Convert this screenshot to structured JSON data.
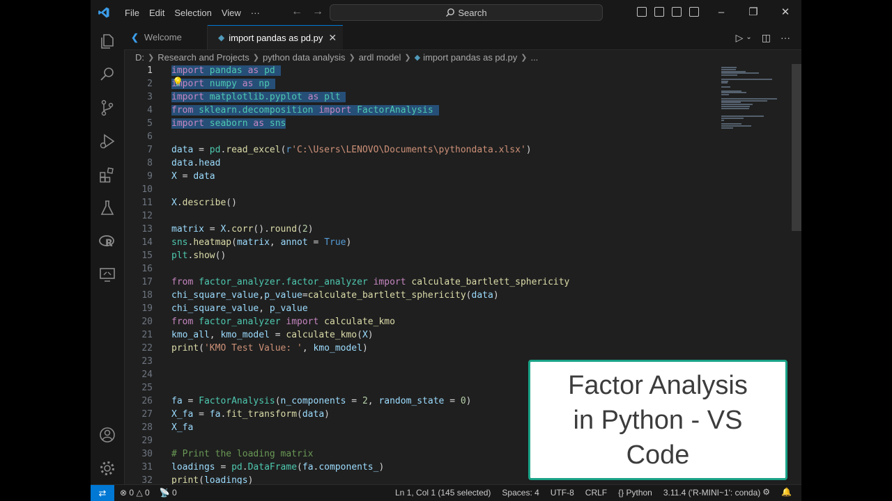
{
  "menu": [
    "File",
    "Edit",
    "Selection",
    "View",
    "···"
  ],
  "search_label": "Search",
  "tabs": [
    {
      "label": "Welcome"
    },
    {
      "label": "import pandas as pd.py"
    }
  ],
  "breadcrumb": [
    "D:",
    "Research and Projects",
    "python data analysis",
    "ardl model",
    "import pandas as pd.py",
    "..."
  ],
  "lines": [
    {
      "n": "1",
      "html": "<span class='sel'><span class='k'>import</span> <span class='t'>pandas</span> <span class='k'>as</span> <span class='t'>pd</span> </span>"
    },
    {
      "n": "2",
      "html": "<span class='sel'><span class='k'>import</span> <span class='t'>numpy</span> <span class='k'>as</span> <span class='t'>np</span> </span>"
    },
    {
      "n": "3",
      "html": "<span class='sel'><span class='k'>import</span> <span class='t'>matplotlib.pyplot</span> <span class='k'>as</span> <span class='t'>plt</span> </span>"
    },
    {
      "n": "4",
      "html": "<span class='sel'><span class='k'>from</span> <span class='t'>sklearn.decomposition</span> <span class='k'>import</span> <span class='t'>FactorAnalysis</span> </span>"
    },
    {
      "n": "5",
      "html": "<span class='sel'><span class='k'>import</span> <span class='t'>seaborn</span> <span class='k'>as</span> <span class='t'>sns</span></span>"
    },
    {
      "n": "6",
      "html": ""
    },
    {
      "n": "7",
      "html": "<span class='v'>data</span> <span class='p'>=</span> <span class='t'>pd</span><span class='p'>.</span><span class='f'>read_excel</span><span class='p'>(</span><span class='b'>r</span><span class='s'>'C:\\Users\\LENOVO\\Documents\\pythondata.xlsx'</span><span class='p'>)</span>"
    },
    {
      "n": "8",
      "html": "<span class='v'>data</span><span class='p'>.</span><span class='v'>head</span>"
    },
    {
      "n": "9",
      "html": "<span class='v'>X</span> <span class='p'>=</span> <span class='v'>data</span>"
    },
    {
      "n": "10",
      "html": ""
    },
    {
      "n": "11",
      "html": "<span class='v'>X</span><span class='p'>.</span><span class='f'>describe</span><span class='p'>()</span>"
    },
    {
      "n": "12",
      "html": ""
    },
    {
      "n": "13",
      "html": "<span class='v'>matrix</span> <span class='p'>=</span> <span class='v'>X</span><span class='p'>.</span><span class='f'>corr</span><span class='p'>().</span><span class='f'>round</span><span class='p'>(</span><span class='n'>2</span><span class='p'>)</span>"
    },
    {
      "n": "14",
      "html": "<span class='t'>sns</span><span class='p'>.</span><span class='f'>heatmap</span><span class='p'>(</span><span class='v'>matrix</span><span class='p'>, </span><span class='v'>annot</span> <span class='p'>=</span> <span class='b'>True</span><span class='p'>)</span>"
    },
    {
      "n": "15",
      "html": "<span class='t'>plt</span><span class='p'>.</span><span class='f'>show</span><span class='p'>()</span>"
    },
    {
      "n": "16",
      "html": ""
    },
    {
      "n": "17",
      "html": "<span class='k'>from</span> <span class='t'>factor_analyzer.factor_analyzer</span> <span class='k'>import</span> <span class='f'>calculate_bartlett_sphericity</span>"
    },
    {
      "n": "18",
      "html": "<span class='v'>chi_square_value</span><span class='p'>,</span><span class='v'>p_value</span><span class='p'>=</span><span class='f'>calculate_bartlett_sphericity</span><span class='p'>(</span><span class='v'>data</span><span class='p'>)</span>"
    },
    {
      "n": "19",
      "html": "<span class='v'>chi_square_value</span><span class='p'>, </span><span class='v'>p_value</span>"
    },
    {
      "n": "20",
      "html": "<span class='k'>from</span> <span class='t'>factor_analyzer</span> <span class='k'>import</span> <span class='f'>calculate_kmo</span>"
    },
    {
      "n": "21",
      "html": "<span class='v'>kmo_all</span><span class='p'>, </span><span class='v'>kmo_model</span> <span class='p'>=</span> <span class='f'>calculate_kmo</span><span class='p'>(</span><span class='v'>X</span><span class='p'>)</span>"
    },
    {
      "n": "22",
      "html": "<span class='f'>print</span><span class='p'>(</span><span class='s'>'KMO Test Value: '</span><span class='p'>, </span><span class='v'>kmo_model</span><span class='p'>)</span>"
    },
    {
      "n": "23",
      "html": ""
    },
    {
      "n": "24",
      "html": ""
    },
    {
      "n": "25",
      "html": ""
    },
    {
      "n": "26",
      "html": "<span class='v'>fa</span> <span class='p'>=</span> <span class='t'>FactorAnalysis</span><span class='p'>(</span><span class='v'>n_components</span> <span class='p'>=</span> <span class='n'>2</span><span class='p'>, </span><span class='v'>random_state</span> <span class='p'>=</span> <span class='n'>0</span><span class='p'>)</span>"
    },
    {
      "n": "27",
      "html": "<span class='v'>X_fa</span> <span class='p'>=</span> <span class='v'>fa</span><span class='p'>.</span><span class='f'>fit_transform</span><span class='p'>(</span><span class='v'>data</span><span class='p'>)</span>"
    },
    {
      "n": "28",
      "html": "<span class='v'>X_fa</span>"
    },
    {
      "n": "29",
      "html": ""
    },
    {
      "n": "30",
      "html": "<span class='c'># Print the loading matrix</span>"
    },
    {
      "n": "31",
      "html": "<span class='v'>loadings</span> <span class='p'>=</span> <span class='t'>pd</span><span class='p'>.</span><span class='t'>DataFrame</span><span class='p'>(</span><span class='v'>fa</span><span class='p'>.</span><span class='v'>components_</span><span class='p'>)</span>"
    },
    {
      "n": "32",
      "html": "<span class='f'>print</span><span class='p'>(</span><span class='v'>loadings</span><span class='p'>)</span>"
    }
  ],
  "overlay": {
    "line1": "Factor Analysis",
    "line2": "in Python - VS",
    "line3": "Code"
  },
  "status": {
    "errors": "0",
    "warnings": "0",
    "ports": "0",
    "position": "Ln 1, Col 1 (145 selected)",
    "spaces": "Spaces: 4",
    "encoding": "UTF-8",
    "eol": "CRLF",
    "language": "Python",
    "interpreter": "3.11.4 ('R-MINI~1': conda)"
  }
}
